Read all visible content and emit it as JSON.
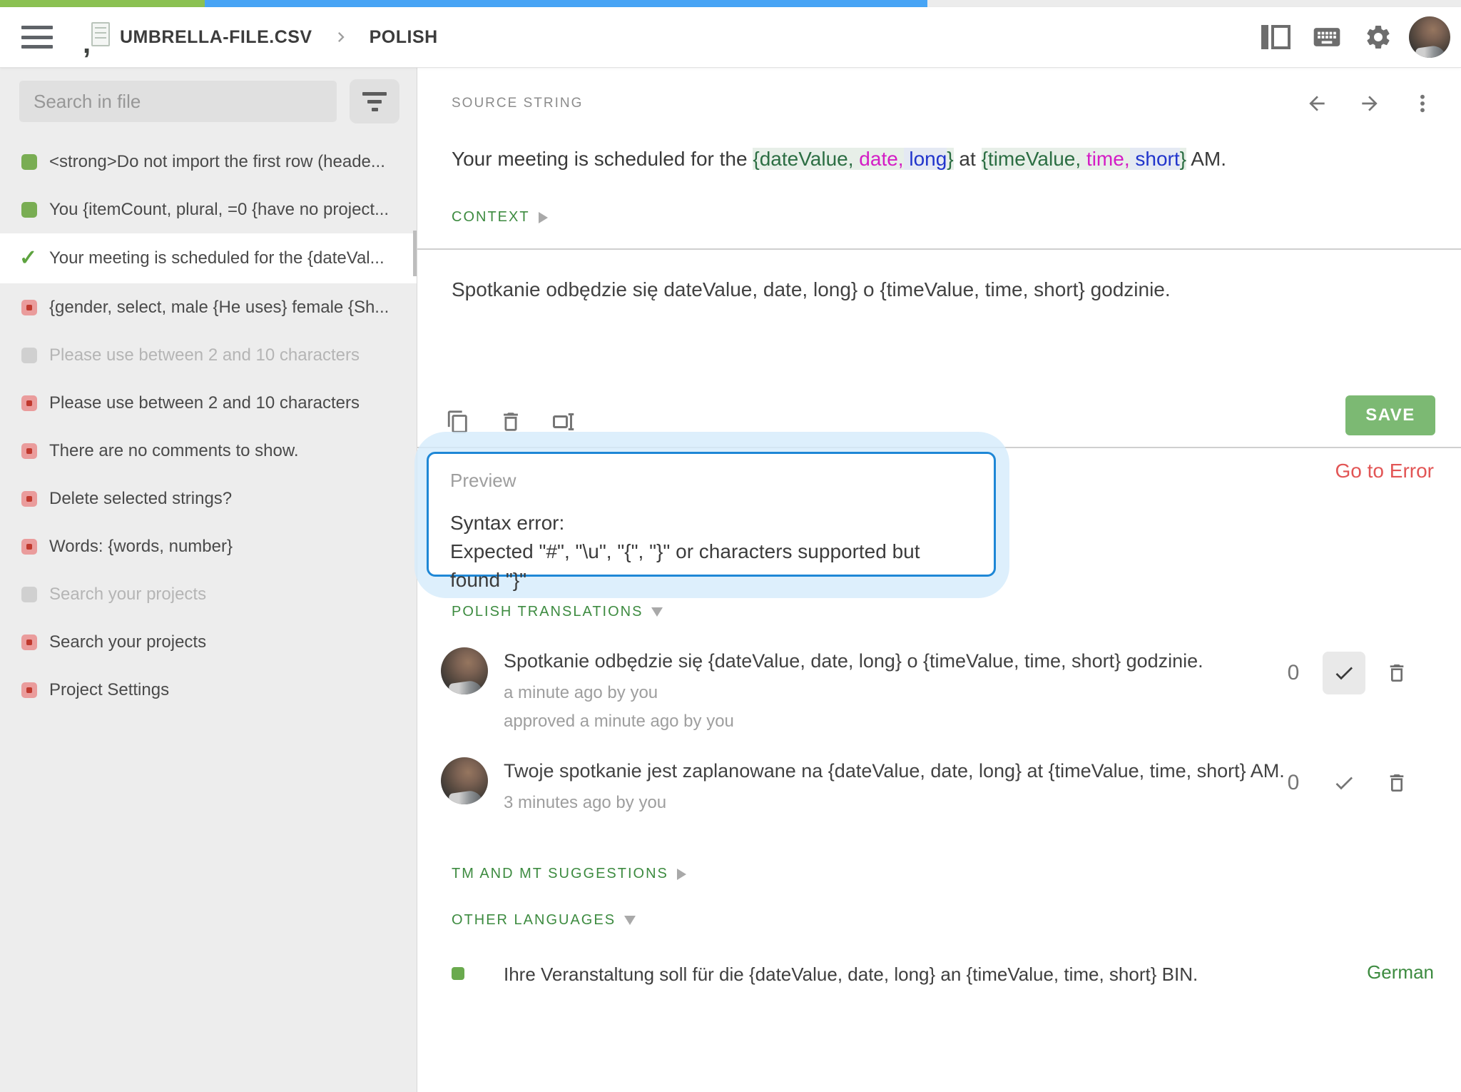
{
  "colors": {
    "progress_green": "#8bc152",
    "progress_blue": "#47a4f5",
    "section_green": "#3d8b40",
    "save_green": "#7cb973",
    "error_red": "#e25555",
    "popup_border_blue": "#1e87d6",
    "placeholder_green": "#2c6e43",
    "placeholder_magenta": "#d41dc5",
    "placeholder_blue": "#2135cc"
  },
  "topbar": {
    "progress_green_pct": 14,
    "progress_blue_pct": 49.5,
    "file_name": "UMBRELLA-FILE.CSV",
    "language": "POLISH"
  },
  "sidebar": {
    "search_placeholder": "Search in file",
    "items": [
      {
        "status": "green",
        "state": "normal",
        "label": "<strong>Do not import the first row (heade..."
      },
      {
        "status": "green",
        "state": "normal",
        "label": "You {itemCount, plural, =0 {have no project..."
      },
      {
        "status": "check",
        "state": "selected",
        "label": "Your meeting is scheduled for the {dateVal..."
      },
      {
        "status": "red",
        "state": "normal",
        "label": "{gender, select, male {He uses} female {Sh..."
      },
      {
        "status": "gray",
        "state": "muted",
        "label": "Please use between 2 and 10 characters"
      },
      {
        "status": "red",
        "state": "normal",
        "label": "Please use between 2 and 10 characters"
      },
      {
        "status": "red",
        "state": "normal",
        "label": "There are no comments to show."
      },
      {
        "status": "red",
        "state": "normal",
        "label": "Delete selected strings?"
      },
      {
        "status": "red",
        "state": "normal",
        "label": "Words: {words, number}"
      },
      {
        "status": "gray",
        "state": "muted",
        "label": "Search your projects"
      },
      {
        "status": "red",
        "state": "normal",
        "label": "Search your projects"
      },
      {
        "status": "red",
        "state": "normal",
        "label": "Project Settings"
      }
    ]
  },
  "source": {
    "label": "SOURCE STRING",
    "context_label": "CONTEXT",
    "segments": [
      {
        "t": "Your meeting is scheduled for the ",
        "c": "plain"
      },
      {
        "t": "{dateValue,",
        "c": "green"
      },
      {
        "t": " date,",
        "c": "magenta"
      },
      {
        "t": " long",
        "c": "blue"
      },
      {
        "t": "}",
        "c": "green"
      },
      {
        "t": " at ",
        "c": "plain"
      },
      {
        "t": "{timeValue,",
        "c": "green"
      },
      {
        "t": " time,",
        "c": "magenta"
      },
      {
        "t": " short",
        "c": "blue"
      },
      {
        "t": "}",
        "c": "green"
      },
      {
        "t": " AM.",
        "c": "plain"
      }
    ]
  },
  "editor": {
    "translation_text": "Spotkanie odbędzie się dateValue, date, long} o {timeValue, time, short} godzinie.",
    "save_label": "SAVE",
    "go_to_error_label": "Go to Error"
  },
  "preview": {
    "title": "Preview",
    "error_line1": "Syntax error:",
    "error_line2": "Expected \"#\", \"\\u\", \"{\", \"}\" or characters supported but found \"}\""
  },
  "translations": {
    "header": "POLISH TRANSLATIONS",
    "entries": [
      {
        "text": "Spotkanie odbędzie się {dateValue, date, long} o {timeValue, time, short} godzinie.",
        "meta1": "a minute ago by you",
        "meta2": "approved a minute ago by you",
        "votes": "0",
        "approved": "yes"
      },
      {
        "text": "Twoje spotkanie jest zaplanowane na {dateValue, date, long} at {timeValue, time, short} AM.",
        "meta1": "3 minutes ago by you",
        "meta2": "",
        "votes": "0",
        "approved": "no"
      }
    ]
  },
  "suggestions": {
    "header": "TM AND MT SUGGESTIONS"
  },
  "other_languages": {
    "header": "OTHER LANGUAGES",
    "rows": [
      {
        "text": "Ihre Veranstaltung soll für die {dateValue, date, long} an {timeValue, time, short} BIN.",
        "language": "German"
      }
    ]
  }
}
